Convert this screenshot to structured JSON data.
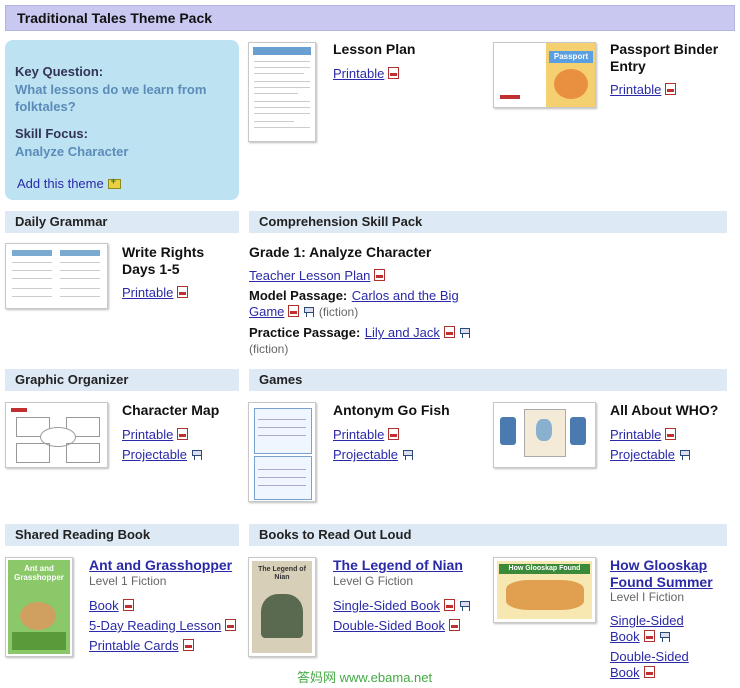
{
  "page_title": "Traditional Tales Theme Pack",
  "key_box": {
    "question_label": "Key Question:",
    "question_text": "What lessons do we learn from folktales?",
    "skill_label": "Skill Focus:",
    "skill_text": "Analyze Character",
    "add_link": "Add this theme"
  },
  "top_items": {
    "lesson_plan": {
      "title": "Lesson Plan",
      "printable": "Printable"
    },
    "passport": {
      "title": "Passport Binder Entry",
      "printable": "Printable"
    }
  },
  "sections": {
    "daily_grammar": "Daily Grammar",
    "comprehension": "Comprehension Skill Pack",
    "graphic_organizer": "Graphic Organizer",
    "games": "Games",
    "shared_reading": "Shared Reading Book",
    "read_aloud": "Books to Read Out Loud"
  },
  "daily_grammar": {
    "title": "Write Rights Days 1-5",
    "printable": "Printable"
  },
  "comprehension": {
    "heading": "Grade 1: Analyze Character",
    "teacher_lesson": "Teacher Lesson Plan",
    "model_label": "Model Passage:",
    "model_link": "Carlos and the Big Game",
    "model_genre": "(fiction)",
    "practice_label": "Practice Passage:",
    "practice_link": "Lily and Jack",
    "practice_genre": "(fiction)"
  },
  "graphic_organizer": {
    "title": "Character Map",
    "printable": "Printable",
    "projectable": "Projectable"
  },
  "games": [
    {
      "title": "Antonym Go Fish",
      "printable": "Printable",
      "projectable": "Projectable"
    },
    {
      "title": "All About WHO?",
      "printable": "Printable",
      "projectable": "Projectable"
    }
  ],
  "shared_reading": {
    "title": "Ant and Grasshopper",
    "level": "Level 1 Fiction",
    "links": [
      "Book",
      "5-Day Reading Lesson",
      "Printable Cards"
    ]
  },
  "read_aloud": [
    {
      "title": "The Legend of Nian",
      "level": "Level G Fiction",
      "links": [
        "Single-Sided Book",
        "Double-Sided Book"
      ]
    },
    {
      "title": "How Glooskap Found Summer",
      "level": "Level I Fiction",
      "links": [
        "Single-Sided Book",
        "Double-Sided Book"
      ]
    }
  ],
  "thumb_text": {
    "passport_cover": "Passport",
    "nian_cover": "The Legend of Nian",
    "glooskap_cover": "How Glooskap Found Summer",
    "ant_cover": "Ant and Grasshopper"
  },
  "watermark": "答妈网 www.ebama.net",
  "colors": {
    "link": "#2a2aa8",
    "title_bar": "#c8c8f0",
    "key_box": "#bde3f3",
    "section_bar": "#dde9f4",
    "key_value": "#5b8bb8"
  }
}
